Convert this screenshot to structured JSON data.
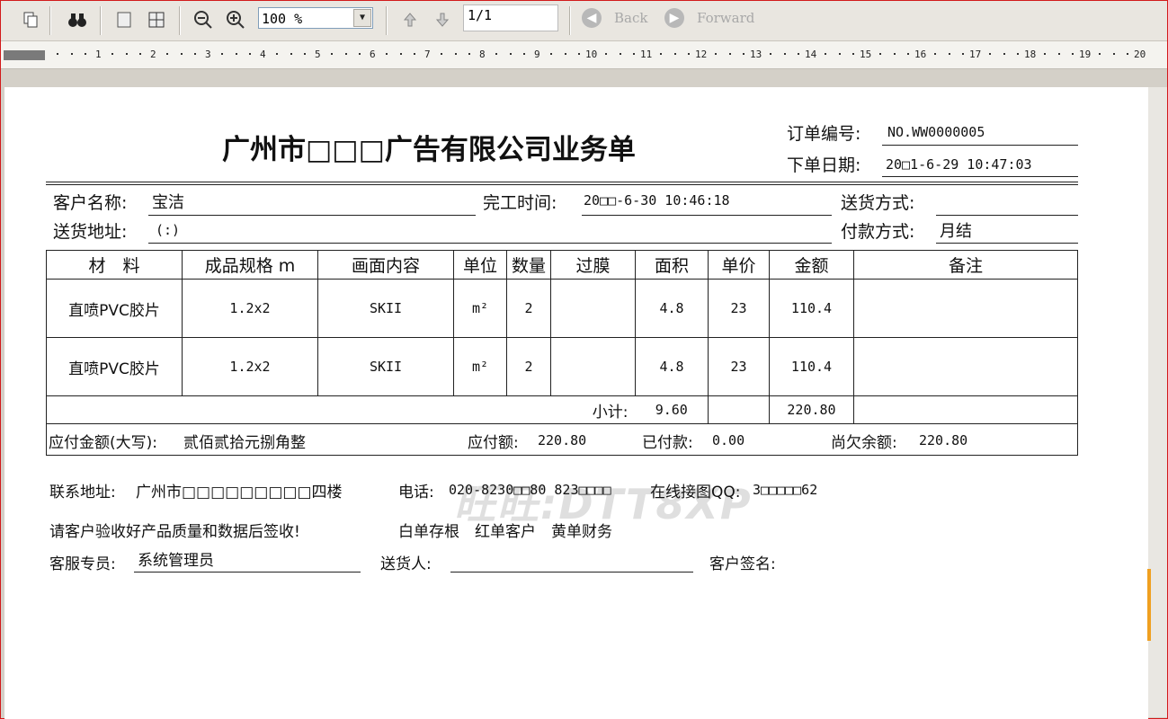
{
  "toolbar": {
    "zoom_value": "100 %",
    "page_value": "1/1",
    "back_label": "Back",
    "forward_label": "Forward"
  },
  "ruler": {
    "numbers": [
      "1",
      "2",
      "3",
      "4",
      "5",
      "6",
      "7",
      "8",
      "9",
      "10",
      "11",
      "12",
      "13",
      "14",
      "15",
      "16",
      "17",
      "18",
      "19",
      "20"
    ]
  },
  "doc": {
    "title": "广州市□□□广告有限公司业务单",
    "order_no_label": "订单编号:",
    "order_no_value": "NO.WW0000005",
    "order_date_label": "下单日期:",
    "order_date_value": "20□1-6-29 10:47:03",
    "customer_label": "客户名称:",
    "customer_value": "宝洁",
    "finish_label": "完工时间:",
    "finish_value": "20□□-6-30 10:46:18",
    "delivery_method_label": "送货方式:",
    "delivery_method_value": "",
    "address_label": "送货地址:",
    "address_value": "(:)",
    "payment_label": "付款方式:",
    "payment_value": "月结",
    "table": {
      "headers": [
        "材　料",
        "成品规格 m",
        "画面内容",
        "单位",
        "数量",
        "过膜",
        "面积",
        "单价",
        "金额",
        "备注"
      ],
      "rows": [
        [
          "直喷PVC胶片",
          "1.2x2",
          "SKII",
          "m²",
          "2",
          "",
          "4.8",
          "23",
          "110.4",
          ""
        ],
        [
          "直喷PVC胶片",
          "1.2x2",
          "SKII",
          "m²",
          "2",
          "",
          "4.8",
          "23",
          "110.4",
          ""
        ]
      ],
      "subtotal_label": "小计:",
      "subtotal_area": "9.60",
      "subtotal_amount": "220.80",
      "amount_words_label": "应付金额(大写):",
      "amount_words_value": "贰佰贰拾元捌角整",
      "payable_label": "应付额:",
      "payable_value": "220.80",
      "paid_label": "已付款:",
      "paid_value": "0.00",
      "owed_label": "尚欠余额:",
      "owed_value": "220.80"
    },
    "contact_label": "联系地址:",
    "contact_value": "广州市□□□□□□□□□四楼",
    "phone_label": "电话:",
    "phone_value": "020-8230□□80  823□□□□",
    "qq_label": "在线接图QQ:",
    "qq_value": "3□□□□□62",
    "notice": "请客户验收好产品质量和数据后签收!",
    "copies": "白单存根　红单客户　黄单财务",
    "service_label": "客服专员:",
    "service_value": "系统管理员",
    "deliverer_label": "送货人:",
    "sign_label": "客户签名:",
    "watermark": "旺旺:DTT8XP"
  }
}
